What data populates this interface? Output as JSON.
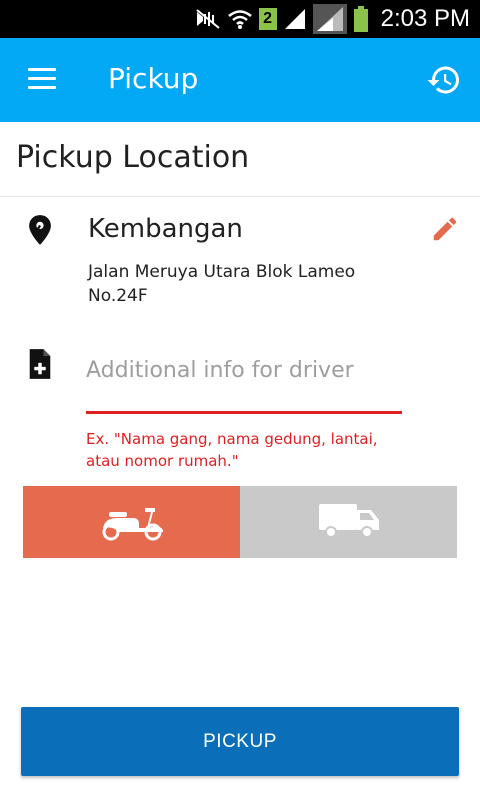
{
  "status_bar": {
    "time": "2:03 PM",
    "sim_label": "2"
  },
  "app_bar": {
    "title": "Pickup",
    "menu_icon": "hamburger-menu-icon",
    "history_icon": "history-icon"
  },
  "pickup_section": {
    "title": "Pickup Location",
    "place_name": "Kembangan",
    "address": "Jalan Meruya Utara Blok Lameo No.24F"
  },
  "additional_info": {
    "placeholder": "Additional info for driver",
    "value": "",
    "hint": "Ex. \"Nama gang, nama gedung, lantai, atau nomor rumah.\""
  },
  "vehicles": [
    {
      "icon": "scooter-icon",
      "selected": true
    },
    {
      "icon": "van-icon",
      "selected": false
    }
  ],
  "pickup_button": {
    "label": "PICKUP"
  },
  "colors": {
    "app_bar": "#03a9f4",
    "accent_orange": "#e56a4e",
    "error_red": "#e02020",
    "button_blue": "#0a6fb8",
    "inactive_gray": "#c9c9c9"
  }
}
